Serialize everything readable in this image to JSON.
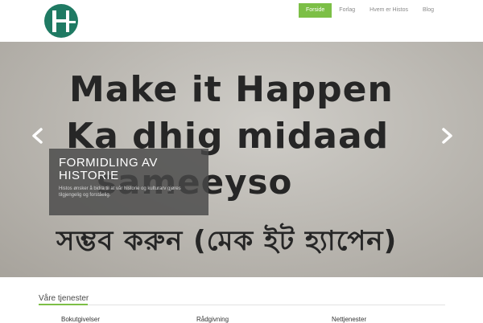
{
  "brand": {
    "logo_icon": "histos-logo-icon",
    "accent_color": "#7cbf46",
    "logo_color": "#1f7a63"
  },
  "nav": {
    "items": [
      {
        "label": "Forside",
        "active": true
      },
      {
        "label": "Forlag",
        "active": false
      },
      {
        "label": "Hvem er Histos",
        "active": false
      },
      {
        "label": "Blog",
        "active": false
      }
    ]
  },
  "hero": {
    "wall_lines": [
      "Make it Happen",
      "Ka dhig midaad",
      "sameeyso",
      "সম্ভব করুন (মেক ইট হ্যাপেন)"
    ],
    "caption_title": "FORMIDLING AV HISTORIE",
    "caption_text": "Histos ønsker å bidra til at vår historie og kulturarv gjøres tilgjengelig og forståelig.",
    "prev_icon": "chevron-left-icon",
    "next_icon": "chevron-right-icon"
  },
  "services": {
    "title": "Våre tjenester",
    "items": [
      "Bokutgivelser",
      "Rådgivning",
      "Nettjenester"
    ]
  }
}
